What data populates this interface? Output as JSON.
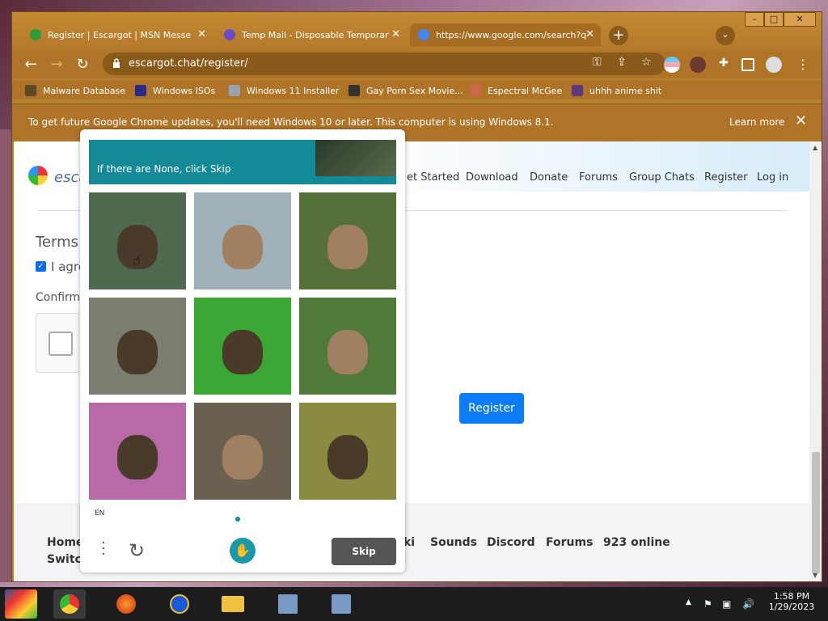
{
  "browser": {
    "tabs": [
      {
        "label": "Register | Escargot | MSN Messe",
        "favicon_color": "#2a9d3a",
        "active": false
      },
      {
        "label": "Temp Mail - Disposable Temporar",
        "favicon_color": "#6a4acb",
        "active": false
      },
      {
        "label": "https://www.google.com/search?q",
        "favicon_color": "#4285f4",
        "active": true
      }
    ],
    "url": "escargot.chat/register/",
    "window_buttons": {
      "minimize": "–",
      "maximize": "□",
      "close": "✕"
    },
    "bookmarks": [
      {
        "label": "Malware Database",
        "icon_color": "#5a4a2a"
      },
      {
        "label": "Windows ISOs",
        "icon_color": "#2a2a8a"
      },
      {
        "label": "Windows 11 Installer",
        "icon_color": "#9aa2b2"
      },
      {
        "label": "Gay Porn Sex Movie...",
        "icon_color": "#333333"
      },
      {
        "label": "Espectral McGee",
        "icon_color": "#c86a4a"
      },
      {
        "label": "uhhh anime shit",
        "icon_color": "#5a3a7a"
      }
    ],
    "infobar": {
      "message": "To get future Google Chrome updates, you'll need Windows 10 or later. This computer is using Windows 8.1.",
      "learn_more": "Learn more",
      "close": "✕"
    }
  },
  "site": {
    "brand": "esca",
    "nav": [
      "et Started",
      "Download",
      "Donate",
      "Forums",
      "Group Chats",
      "Register",
      "Log in"
    ],
    "terms_heading": "Terms",
    "agree_label": "I agre",
    "confirm_label": "Confirm",
    "register_button": "Register",
    "footer_links": [
      "Home",
      "Switch",
      "ki",
      "Sounds",
      "Discord",
      "Forums",
      "923 online"
    ]
  },
  "captcha": {
    "instruction": "If there are None, click Skip",
    "language": "EN",
    "skip_label": "Skip",
    "tiles": [
      {
        "subject": "otter",
        "bg": "#4f6a50"
      },
      {
        "subject": "rabbit",
        "bg": "#9fb1b8"
      },
      {
        "subject": "rabbit",
        "bg": "#56703a"
      },
      {
        "subject": "otter",
        "bg": "#7b7d70"
      },
      {
        "subject": "otter",
        "bg": "#3aa634"
      },
      {
        "subject": "rabbit",
        "bg": "#4f7a3a"
      },
      {
        "subject": "otter",
        "bg": "#b86aa8"
      },
      {
        "subject": "rabbit",
        "bg": "#6a6050"
      },
      {
        "subject": "otter",
        "bg": "#8a8a40"
      }
    ]
  },
  "taskbar": {
    "clock_time": "1:58 PM",
    "clock_date": "1/29/2023",
    "apps": [
      "start",
      "chrome",
      "firefox",
      "ie",
      "explorer",
      "installer-1",
      "installer-2"
    ]
  },
  "colors": {
    "chrome_frame": "#b5822e",
    "register_button": "#0b7cf6",
    "captcha_header": "#148a96"
  }
}
